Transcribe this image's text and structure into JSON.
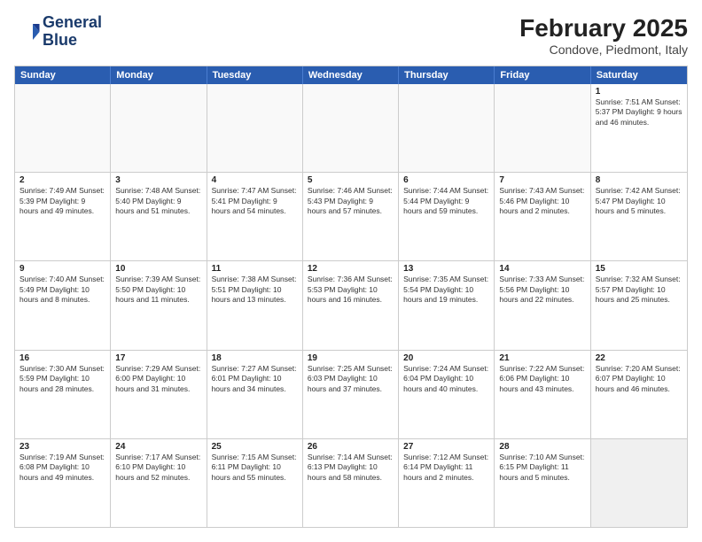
{
  "header": {
    "logo_line1": "General",
    "logo_line2": "Blue",
    "month_title": "February 2025",
    "location": "Condove, Piedmont, Italy"
  },
  "weekdays": [
    "Sunday",
    "Monday",
    "Tuesday",
    "Wednesday",
    "Thursday",
    "Friday",
    "Saturday"
  ],
  "rows": [
    [
      {
        "day": "",
        "info": "",
        "empty": true
      },
      {
        "day": "",
        "info": "",
        "empty": true
      },
      {
        "day": "",
        "info": "",
        "empty": true
      },
      {
        "day": "",
        "info": "",
        "empty": true
      },
      {
        "day": "",
        "info": "",
        "empty": true
      },
      {
        "day": "",
        "info": "",
        "empty": true
      },
      {
        "day": "1",
        "info": "Sunrise: 7:51 AM\nSunset: 5:37 PM\nDaylight: 9 hours and 46 minutes."
      }
    ],
    [
      {
        "day": "2",
        "info": "Sunrise: 7:49 AM\nSunset: 5:39 PM\nDaylight: 9 hours and 49 minutes."
      },
      {
        "day": "3",
        "info": "Sunrise: 7:48 AM\nSunset: 5:40 PM\nDaylight: 9 hours and 51 minutes."
      },
      {
        "day": "4",
        "info": "Sunrise: 7:47 AM\nSunset: 5:41 PM\nDaylight: 9 hours and 54 minutes."
      },
      {
        "day": "5",
        "info": "Sunrise: 7:46 AM\nSunset: 5:43 PM\nDaylight: 9 hours and 57 minutes."
      },
      {
        "day": "6",
        "info": "Sunrise: 7:44 AM\nSunset: 5:44 PM\nDaylight: 9 hours and 59 minutes."
      },
      {
        "day": "7",
        "info": "Sunrise: 7:43 AM\nSunset: 5:46 PM\nDaylight: 10 hours and 2 minutes."
      },
      {
        "day": "8",
        "info": "Sunrise: 7:42 AM\nSunset: 5:47 PM\nDaylight: 10 hours and 5 minutes."
      }
    ],
    [
      {
        "day": "9",
        "info": "Sunrise: 7:40 AM\nSunset: 5:49 PM\nDaylight: 10 hours and 8 minutes."
      },
      {
        "day": "10",
        "info": "Sunrise: 7:39 AM\nSunset: 5:50 PM\nDaylight: 10 hours and 11 minutes."
      },
      {
        "day": "11",
        "info": "Sunrise: 7:38 AM\nSunset: 5:51 PM\nDaylight: 10 hours and 13 minutes."
      },
      {
        "day": "12",
        "info": "Sunrise: 7:36 AM\nSunset: 5:53 PM\nDaylight: 10 hours and 16 minutes."
      },
      {
        "day": "13",
        "info": "Sunrise: 7:35 AM\nSunset: 5:54 PM\nDaylight: 10 hours and 19 minutes."
      },
      {
        "day": "14",
        "info": "Sunrise: 7:33 AM\nSunset: 5:56 PM\nDaylight: 10 hours and 22 minutes."
      },
      {
        "day": "15",
        "info": "Sunrise: 7:32 AM\nSunset: 5:57 PM\nDaylight: 10 hours and 25 minutes."
      }
    ],
    [
      {
        "day": "16",
        "info": "Sunrise: 7:30 AM\nSunset: 5:59 PM\nDaylight: 10 hours and 28 minutes."
      },
      {
        "day": "17",
        "info": "Sunrise: 7:29 AM\nSunset: 6:00 PM\nDaylight: 10 hours and 31 minutes."
      },
      {
        "day": "18",
        "info": "Sunrise: 7:27 AM\nSunset: 6:01 PM\nDaylight: 10 hours and 34 minutes."
      },
      {
        "day": "19",
        "info": "Sunrise: 7:25 AM\nSunset: 6:03 PM\nDaylight: 10 hours and 37 minutes."
      },
      {
        "day": "20",
        "info": "Sunrise: 7:24 AM\nSunset: 6:04 PM\nDaylight: 10 hours and 40 minutes."
      },
      {
        "day": "21",
        "info": "Sunrise: 7:22 AM\nSunset: 6:06 PM\nDaylight: 10 hours and 43 minutes."
      },
      {
        "day": "22",
        "info": "Sunrise: 7:20 AM\nSunset: 6:07 PM\nDaylight: 10 hours and 46 minutes."
      }
    ],
    [
      {
        "day": "23",
        "info": "Sunrise: 7:19 AM\nSunset: 6:08 PM\nDaylight: 10 hours and 49 minutes."
      },
      {
        "day": "24",
        "info": "Sunrise: 7:17 AM\nSunset: 6:10 PM\nDaylight: 10 hours and 52 minutes."
      },
      {
        "day": "25",
        "info": "Sunrise: 7:15 AM\nSunset: 6:11 PM\nDaylight: 10 hours and 55 minutes."
      },
      {
        "day": "26",
        "info": "Sunrise: 7:14 AM\nSunset: 6:13 PM\nDaylight: 10 hours and 58 minutes."
      },
      {
        "day": "27",
        "info": "Sunrise: 7:12 AM\nSunset: 6:14 PM\nDaylight: 11 hours and 2 minutes."
      },
      {
        "day": "28",
        "info": "Sunrise: 7:10 AM\nSunset: 6:15 PM\nDaylight: 11 hours and 5 minutes."
      },
      {
        "day": "",
        "info": "",
        "empty": true,
        "shaded": true
      }
    ]
  ]
}
